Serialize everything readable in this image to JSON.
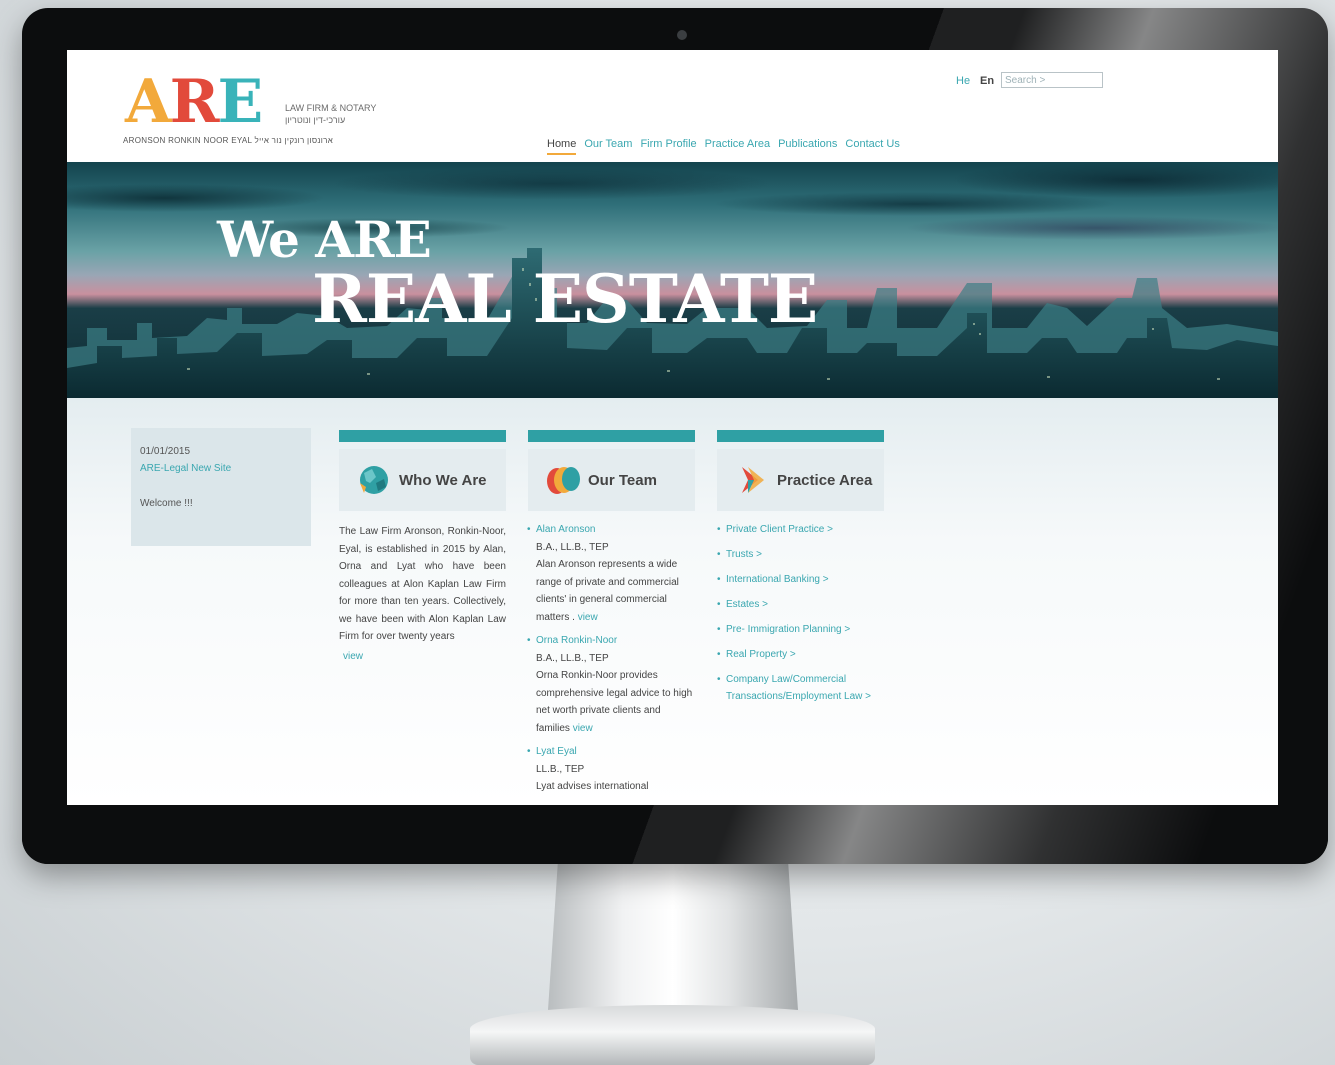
{
  "header": {
    "logo": [
      "A",
      "R",
      "E"
    ],
    "tagline_en": "LAW FIRM & NOTARY",
    "tagline_he": "עורכי-דין ונוטריון",
    "firm_name": "ARONSON RONKIN NOOR EYAL  ארונסון רונקין נור אייל",
    "lang_he": "He",
    "lang_en": "En",
    "search_placeholder": "Search >",
    "nav": [
      "Home",
      "Our Team",
      "Firm Profile",
      "Practice Area",
      "Publications",
      "Contact Us"
    ]
  },
  "hero": {
    "line1": "We ARE",
    "line2": "REAL ESTATE"
  },
  "news": {
    "date": "01/01/2015",
    "title": "ARE-Legal New Site",
    "welcome": "Welcome !!!"
  },
  "who": {
    "heading": "Who We Are",
    "text": "The Law Firm Aronson, Ronkin-Noor, Eyal, is established in 2015 by Alan, Orna and Lyat who have been colleagues at Alon Kaplan Law Firm for more than ten years. Collectively, we have been with Alon Kaplan Law Firm for over twenty years",
    "view": "view"
  },
  "team": {
    "heading": "Our Team",
    "members": [
      {
        "name": "Alan Aronson",
        "degrees": "B.A., LL.B., TEP",
        "desc": "Alan Aronson represents a wide range of private and commercial clients' in general commercial matters .",
        "view": "view"
      },
      {
        "name": "Orna Ronkin-Noor",
        "degrees": "B.A., LL.B., TEP",
        "desc": "Orna Ronkin-Noor provides comprehensive legal advice to high net worth private clients and families",
        "view": "view"
      },
      {
        "name": "Lyat Eyal",
        "degrees": "LL.B., TEP",
        "desc": "Lyat advises international",
        "view": ""
      }
    ]
  },
  "practice": {
    "heading": "Practice Area",
    "items": [
      "Private Client Practice >",
      "Trusts >",
      "International Banking >",
      "Estates >",
      "Pre- Immigration Planning >",
      "Real Property >",
      "Company Law/Commercial Transactions/Employment Law >"
    ]
  },
  "colors": {
    "teal": "#2fa0a4",
    "link": "#3aa7b0",
    "orange": "#f2a93b",
    "red": "#e24a3b"
  }
}
